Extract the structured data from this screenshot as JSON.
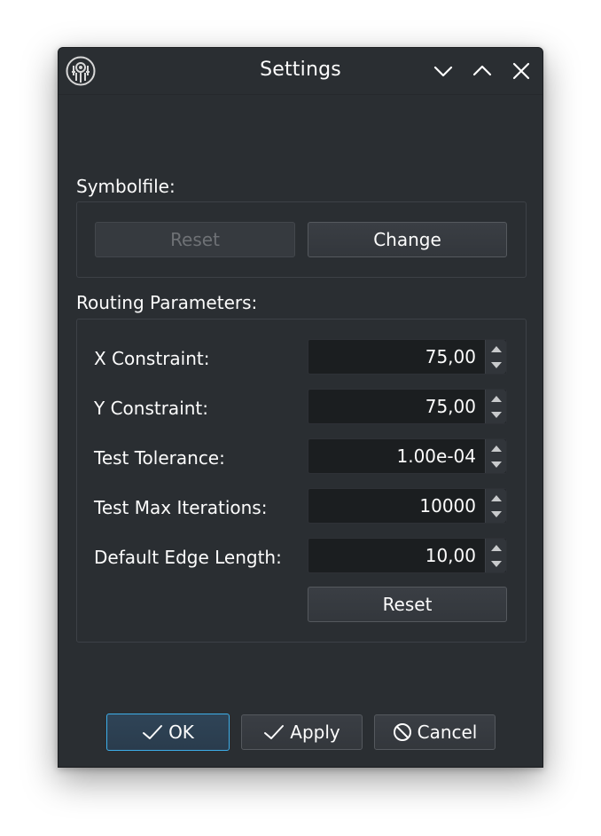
{
  "window": {
    "title": "Settings",
    "title_buttons": [
      "minimize",
      "maximize",
      "close"
    ]
  },
  "symbolfile": {
    "label": "Symbolfile:",
    "reset_label": "Reset",
    "reset_enabled": false,
    "change_label": "Change"
  },
  "routing": {
    "label": "Routing Parameters:",
    "params": [
      {
        "label": "X Constraint:",
        "value": "75,00"
      },
      {
        "label": "Y Constraint:",
        "value": "75,00"
      },
      {
        "label": "Test Tolerance:",
        "value": "1.00e-04"
      },
      {
        "label": "Test Max Iterations:",
        "value": "10000"
      },
      {
        "label": "Default Edge Length:",
        "value": "10,00"
      }
    ],
    "reset_label": "Reset"
  },
  "buttons": {
    "ok_label": "OK",
    "apply_label": "Apply",
    "cancel_label": "Cancel"
  },
  "colors": {
    "window_bg": "#2a2e32",
    "field_bg": "#1b1e20",
    "accent": "#3daee9",
    "text": "#fcfcfc",
    "disabled_text": "#6e7175"
  },
  "icons": {
    "app": "app-logo-icon",
    "minimize": "chevron-down-icon",
    "maximize": "chevron-up-icon",
    "close": "close-icon",
    "ok": "checkmark-icon",
    "apply": "checkmark-icon",
    "cancel": "cancel-icon",
    "spin_up": "spin-up-arrow-icon",
    "spin_down": "spin-down-arrow-icon"
  }
}
